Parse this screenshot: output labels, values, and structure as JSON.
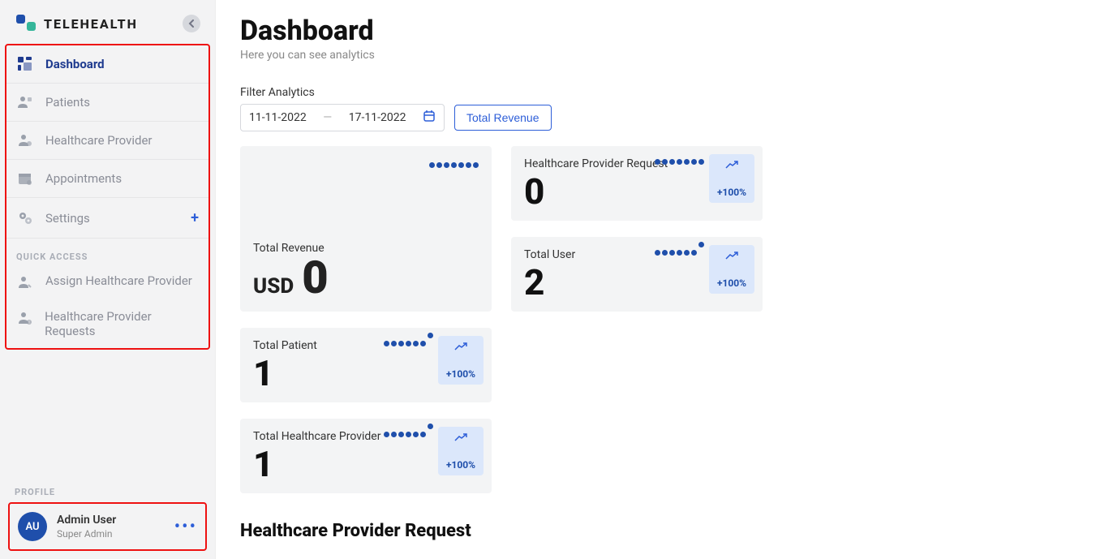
{
  "brand": {
    "text": "TELEHEALTH"
  },
  "sidebar": {
    "items": [
      {
        "label": "Dashboard"
      },
      {
        "label": "Patients"
      },
      {
        "label": "Healthcare Provider"
      },
      {
        "label": "Appointments"
      },
      {
        "label": "Settings"
      }
    ],
    "quick_title": "QUICK ACCESS",
    "quick_items": [
      {
        "label": "Assign Healthcare Provider"
      },
      {
        "label": "Healthcare Provider Requests"
      }
    ]
  },
  "profile": {
    "title": "PROFILE",
    "initials": "AU",
    "name": "Admin User",
    "role": "Super Admin"
  },
  "page": {
    "title": "Dashboard",
    "subtitle": "Here you can see analytics"
  },
  "filter": {
    "label": "Filter Analytics",
    "start": "11-11-2022",
    "end": "17-11-2022",
    "button_label": "Total Revenue"
  },
  "cards": {
    "revenue": {
      "title": "Total Revenue",
      "currency": "USD",
      "amount": "0"
    },
    "provider_request": {
      "title": "Healthcare Provider Request",
      "value": "0",
      "change": "+100%"
    },
    "total_user": {
      "title": "Total User",
      "value": "2",
      "change": "+100%"
    },
    "total_patient": {
      "title": "Total Patient",
      "value": "1",
      "change": "+100%"
    },
    "total_hcp": {
      "title": "Total Healthcare Provider",
      "value": "1",
      "change": "+100%"
    }
  },
  "section": {
    "hpr_title": "Healthcare Provider Request"
  }
}
